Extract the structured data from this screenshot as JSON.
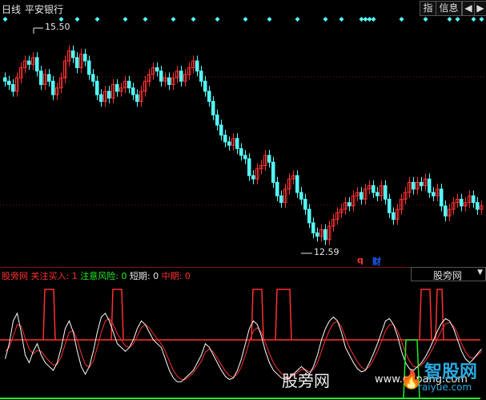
{
  "window": {
    "period_label": "日线",
    "stock_name": "平安银行",
    "buttons": {
      "zhi": "指",
      "info": "信息",
      "back": "◀",
      "forward": "▶"
    }
  },
  "colors": {
    "background": "#000000",
    "up_candle": "#ff3232",
    "down_candle": "#54ffff",
    "diamond": "#54ffff",
    "signal_line": "#ff3030",
    "ma_white": "#ffffff",
    "ma_red": "#ff3030",
    "risk_green": "#22ee22",
    "grid_red": "#7a1a1a"
  },
  "price_labels": {
    "high": "15.50",
    "low": "12.59"
  },
  "badges": {
    "q": "q",
    "cai": "财"
  },
  "indicator": {
    "name": "股旁网",
    "buy_label": "关注买入",
    "buy_value": "1",
    "risk_label": "注意风险",
    "risk_value": "0",
    "short_label": "短期",
    "short_value": "0",
    "mid_label": "中期",
    "mid_value": "0",
    "dropdown_selected": "股旁网",
    "dropdown_arrow": "▼"
  },
  "watermarks": {
    "site_cn": "股旁网",
    "site_url": "www.gupang.com",
    "site2_cn": "智股网",
    "site2_url": "raiyue.com",
    "flame": "🔥"
  },
  "chart_data": {
    "type": "candlestick",
    "price_high_label": 15.5,
    "price_low_label": 12.59,
    "ylim": [
      12.4,
      15.8
    ],
    "closes": [
      15.0,
      14.95,
      14.85,
      15.05,
      15.2,
      15.3,
      15.25,
      15.35,
      15.15,
      14.95,
      15.1,
      15.0,
      14.8,
      14.9,
      15.05,
      15.3,
      15.45,
      15.35,
      15.2,
      15.4,
      15.3,
      15.1,
      15.0,
      14.8,
      14.7,
      14.85,
      14.75,
      14.95,
      14.85,
      14.9,
      15.0,
      14.9,
      14.8,
      14.7,
      14.85,
      15.0,
      15.1,
      15.2,
      15.15,
      15.0,
      15.05,
      14.95,
      15.05,
      15.15,
      15.0,
      15.1,
      15.2,
      15.3,
      15.15,
      15.0,
      14.85,
      14.7,
      14.5,
      14.35,
      14.2,
      14.1,
      14.05,
      14.15,
      14.0,
      13.9,
      13.85,
      13.6,
      13.55,
      13.7,
      13.75,
      13.9,
      13.8,
      13.5,
      13.3,
      13.2,
      13.4,
      13.55,
      13.6,
      13.35,
      13.25,
      13.1,
      12.9,
      12.75,
      12.7,
      12.8,
      12.65,
      12.85,
      12.95,
      13.05,
      13.1,
      13.2,
      13.15,
      13.3,
      13.35,
      13.25,
      13.4,
      13.45,
      13.35,
      13.3,
      13.45,
      13.25,
      13.05,
      12.95,
      13.1,
      13.25,
      13.35,
      13.5,
      13.4,
      13.5,
      13.45,
      13.55,
      13.35,
      13.3,
      13.4,
      13.15,
      13.0,
      13.1,
      13.2,
      13.25,
      13.15,
      13.2,
      13.3,
      13.2,
      13.1,
      13.15
    ],
    "diamond_positions": [
      0,
      14,
      18,
      23,
      30,
      35,
      42,
      47,
      53,
      60,
      66,
      73,
      80,
      84,
      89,
      90,
      91,
      92,
      99,
      105,
      111,
      113,
      117,
      119
    ],
    "signal_spikes": [
      [
        10,
        13
      ],
      [
        27,
        30
      ],
      [
        62,
        65
      ],
      [
        68,
        72
      ],
      [
        104,
        107
      ],
      [
        108,
        110
      ]
    ],
    "ma_white": [
      0.35,
      0.55,
      0.85,
      0.95,
      0.7,
      0.4,
      0.3,
      0.45,
      0.55,
      0.4,
      0.3,
      0.25,
      0.2,
      0.3,
      0.5,
      0.75,
      0.85,
      0.7,
      0.45,
      0.25,
      0.15,
      0.25,
      0.45,
      0.7,
      0.9,
      0.95,
      0.85,
      0.7,
      0.55,
      0.5,
      0.45,
      0.5,
      0.6,
      0.75,
      0.85,
      0.8,
      0.7,
      0.6,
      0.55,
      0.5,
      0.35,
      0.2,
      0.1,
      0.05,
      0.05,
      0.1,
      0.15,
      0.2,
      0.3,
      0.4,
      0.55,
      0.5,
      0.4,
      0.3,
      0.2,
      0.12,
      0.08,
      0.1,
      0.2,
      0.35,
      0.55,
      0.75,
      0.85,
      0.8,
      0.65,
      0.45,
      0.3,
      0.2,
      0.15,
      0.1,
      0.08,
      0.1,
      0.15,
      0.2,
      0.25,
      0.2,
      0.15,
      0.25,
      0.4,
      0.6,
      0.75,
      0.85,
      0.9,
      0.85,
      0.7,
      0.5,
      0.4,
      0.3,
      0.22,
      0.18,
      0.2,
      0.3,
      0.42,
      0.55,
      0.7,
      0.85,
      0.88,
      0.8,
      0.65,
      0.45,
      0.3,
      0.22,
      0.2,
      0.25,
      0.3,
      0.38,
      0.48,
      0.6,
      0.72,
      0.82,
      0.88,
      0.85,
      0.75,
      0.6,
      0.45,
      0.35,
      0.3,
      0.35,
      0.42,
      0.48
    ],
    "ma_red": [
      0.45,
      0.5,
      0.65,
      0.8,
      0.78,
      0.62,
      0.48,
      0.42,
      0.46,
      0.45,
      0.38,
      0.32,
      0.27,
      0.28,
      0.38,
      0.55,
      0.7,
      0.72,
      0.6,
      0.42,
      0.28,
      0.24,
      0.32,
      0.5,
      0.7,
      0.85,
      0.88,
      0.8,
      0.68,
      0.6,
      0.52,
      0.5,
      0.55,
      0.65,
      0.76,
      0.8,
      0.76,
      0.68,
      0.61,
      0.55,
      0.45,
      0.32,
      0.2,
      0.12,
      0.08,
      0.08,
      0.12,
      0.17,
      0.24,
      0.32,
      0.44,
      0.48,
      0.44,
      0.36,
      0.27,
      0.19,
      0.13,
      0.11,
      0.15,
      0.25,
      0.4,
      0.58,
      0.72,
      0.76,
      0.7,
      0.56,
      0.42,
      0.3,
      0.22,
      0.16,
      0.12,
      0.11,
      0.13,
      0.17,
      0.21,
      0.21,
      0.18,
      0.21,
      0.3,
      0.45,
      0.6,
      0.73,
      0.82,
      0.84,
      0.77,
      0.63,
      0.5,
      0.4,
      0.31,
      0.24,
      0.21,
      0.25,
      0.34,
      0.45,
      0.58,
      0.72,
      0.8,
      0.8,
      0.72,
      0.58,
      0.43,
      0.32,
      0.25,
      0.24,
      0.27,
      0.33,
      0.41,
      0.51,
      0.62,
      0.73,
      0.81,
      0.83,
      0.78,
      0.68,
      0.55,
      0.44,
      0.37,
      0.36,
      0.4,
      0.45
    ],
    "risk_spike": [
      100,
      104
    ]
  }
}
